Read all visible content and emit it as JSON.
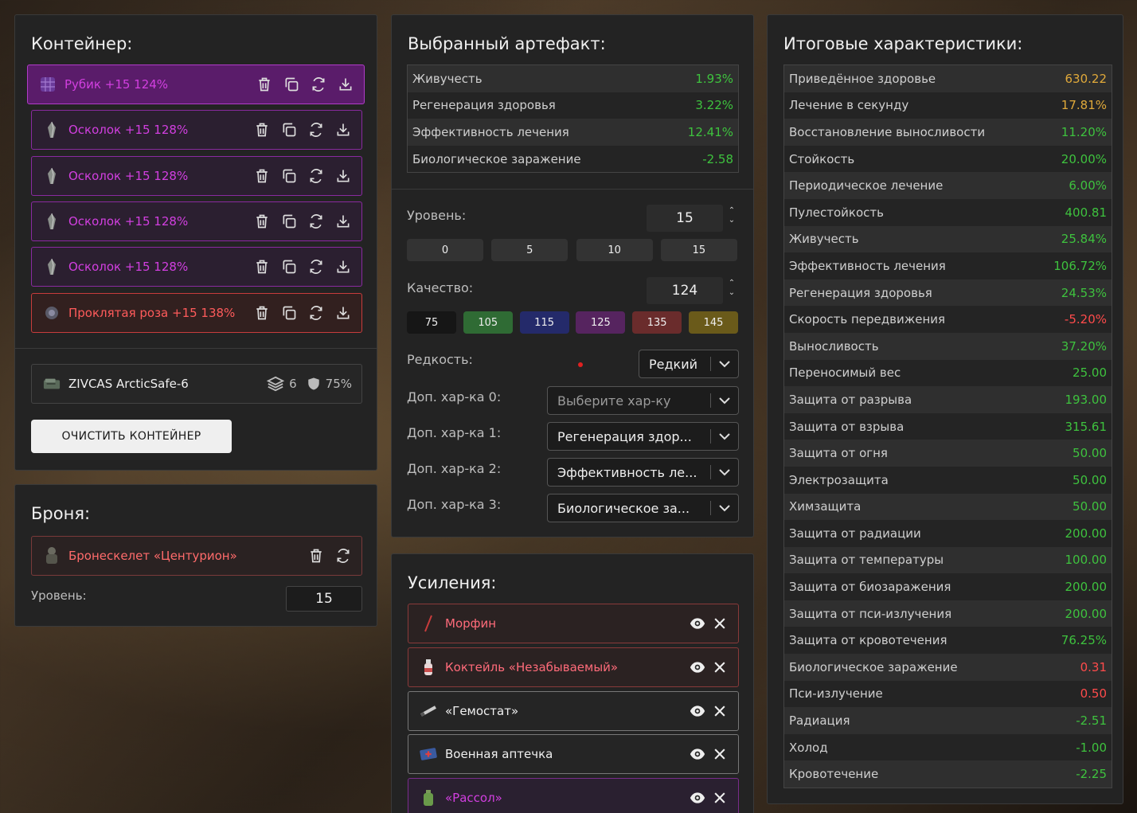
{
  "container": {
    "title": "Контейнер:",
    "artifacts": [
      {
        "name": "Рубик +15 124%",
        "type": "rubik"
      },
      {
        "name": "Осколок +15 128%",
        "type": "shard"
      },
      {
        "name": "Осколок +15 128%",
        "type": "shard"
      },
      {
        "name": "Осколок +15 128%",
        "type": "shard"
      },
      {
        "name": "Осколок +15 128%",
        "type": "shard"
      },
      {
        "name": "Проклятая роза +15 138%",
        "type": "rose"
      }
    ],
    "container_name": "ZIVCAS ArcticSafe-6",
    "slots": "6",
    "protection": "75%",
    "clear_label": "ОЧИСТИТЬ КОНТЕЙНЕР"
  },
  "armor": {
    "title": "Броня:",
    "name": "Бронескелет «Центурион»",
    "level_label": "Уровень:",
    "level": "15"
  },
  "artifact": {
    "title": "Выбранный артефакт:",
    "stats": [
      {
        "name": "Живучесть",
        "value": "1.93%",
        "color": "green"
      },
      {
        "name": "Регенерация здоровья",
        "value": "3.22%",
        "color": "green"
      },
      {
        "name": "Эффективность лечения",
        "value": "12.41%",
        "color": "green"
      },
      {
        "name": "Биологическое заражение",
        "value": "-2.58",
        "color": "green"
      }
    ],
    "level_label": "Уровень:",
    "level": "15",
    "level_presets": [
      "0",
      "5",
      "10",
      "15"
    ],
    "quality_label": "Качество:",
    "quality": "124",
    "quality_presets": [
      {
        "label": "75",
        "bg": "#161616"
      },
      {
        "label": "105",
        "bg": "#2f6b34"
      },
      {
        "label": "115",
        "bg": "#242a6a"
      },
      {
        "label": "125",
        "bg": "#56245f"
      },
      {
        "label": "135",
        "bg": "#6a2c2c"
      },
      {
        "label": "145",
        "bg": "#6a5a1a"
      }
    ],
    "rarity_label": "Редкость:",
    "rarity": "Редкий",
    "extra": [
      {
        "label": "Доп. хар-ка 0:",
        "value": "Выберите хар-ку",
        "placeholder": true
      },
      {
        "label": "Доп. хар-ка 1:",
        "value": "Регенерация здор..."
      },
      {
        "label": "Доп. хар-ка 2:",
        "value": "Эффективность ле..."
      },
      {
        "label": "Доп. хар-ка 3:",
        "value": "Биологическое за..."
      }
    ]
  },
  "boosts": {
    "title": "Усиления:",
    "items": [
      {
        "name": "Морфин",
        "style": "red"
      },
      {
        "name": "Коктейль «Незабываемый»",
        "style": "red"
      },
      {
        "name": "«Гемостат»",
        "style": "white"
      },
      {
        "name": "Военная аптечка",
        "style": "white"
      },
      {
        "name": "«Рассол»",
        "style": "purple"
      }
    ]
  },
  "totals": {
    "title": "Итоговые характеристики:",
    "stats": [
      {
        "name": "Приведённое здоровье",
        "value": "630.22",
        "color": "yellow"
      },
      {
        "name": "Лечение в секунду",
        "value": "17.81%",
        "color": "yellow"
      },
      {
        "name": "Восстановление выносливости",
        "value": "11.20%",
        "color": "green"
      },
      {
        "name": "Стойкость",
        "value": "20.00%",
        "color": "green"
      },
      {
        "name": "Периодическое лечение",
        "value": "6.00%",
        "color": "green"
      },
      {
        "name": "Пулестойкость",
        "value": "400.81",
        "color": "green"
      },
      {
        "name": "Живучесть",
        "value": "25.84%",
        "color": "green"
      },
      {
        "name": "Эффективность лечения",
        "value": "106.72%",
        "color": "green"
      },
      {
        "name": "Регенерация здоровья",
        "value": "24.53%",
        "color": "green"
      },
      {
        "name": "Скорость передвижения",
        "value": "-5.20%",
        "color": "red"
      },
      {
        "name": "Выносливость",
        "value": "37.20%",
        "color": "green"
      },
      {
        "name": "Переносимый вес",
        "value": "25.00",
        "color": "green"
      },
      {
        "name": "Защита от разрыва",
        "value": "193.00",
        "color": "green"
      },
      {
        "name": "Защита от взрыва",
        "value": "315.61",
        "color": "green"
      },
      {
        "name": "Защита от огня",
        "value": "50.00",
        "color": "green"
      },
      {
        "name": "Электрозащита",
        "value": "50.00",
        "color": "green"
      },
      {
        "name": "Химзащита",
        "value": "50.00",
        "color": "green"
      },
      {
        "name": "Защита от радиации",
        "value": "200.00",
        "color": "green"
      },
      {
        "name": "Защита от температуры",
        "value": "100.00",
        "color": "green"
      },
      {
        "name": "Защита от биозаражения",
        "value": "200.00",
        "color": "green"
      },
      {
        "name": "Защита от пси-излучения",
        "value": "200.00",
        "color": "green"
      },
      {
        "name": "Защита от кровотечения",
        "value": "76.25%",
        "color": "green"
      },
      {
        "name": "Биологическое заражение",
        "value": "0.31",
        "color": "red"
      },
      {
        "name": "Пси-излучение",
        "value": "0.50",
        "color": "red"
      },
      {
        "name": "Радиация",
        "value": "-2.51",
        "color": "green"
      },
      {
        "name": "Холод",
        "value": "-1.00",
        "color": "green"
      },
      {
        "name": "Кровотечение",
        "value": "-2.25",
        "color": "green"
      }
    ]
  }
}
